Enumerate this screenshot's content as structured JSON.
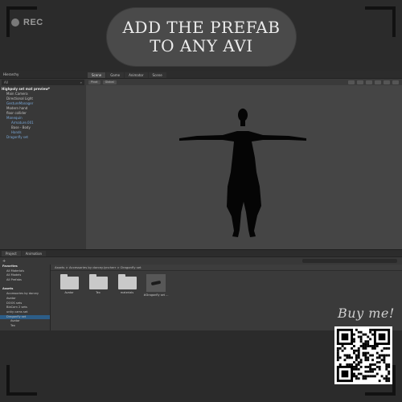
{
  "overlay": {
    "rec_label": "REC",
    "banner_line1": "ADD THE PREFAB",
    "banner_line2": "TO ANY AVI",
    "buy_label": "Buy me!"
  },
  "hierarchy": {
    "tab_label": "Hierarchy",
    "search_placeholder": "All",
    "items": [
      {
        "label": "Highpoly set mat preview*",
        "style": "root"
      },
      {
        "label": "Main Camera",
        "style": ""
      },
      {
        "label": "Directional Light",
        "style": ""
      },
      {
        "label": "GestureManager",
        "style": "blue"
      },
      {
        "label": "Modern hand",
        "style": ""
      },
      {
        "label": "floor collider",
        "style": ""
      },
      {
        "label": "Manequin",
        "style": "blue"
      },
      {
        "label": "Armature.001",
        "style": "blue"
      },
      {
        "label": "Base - Body",
        "style": ""
      },
      {
        "label": "Hands",
        "style": "blue"
      },
      {
        "label": "Dragonfly set",
        "style": "blue"
      }
    ]
  },
  "scene": {
    "tabs": [
      "Scene",
      "Game",
      "Animator",
      "Scene"
    ],
    "active_tab": 0,
    "toolbar": [
      "Pivot",
      "Global"
    ]
  },
  "bottom": {
    "tabs": [
      "Project",
      "Animation"
    ],
    "active_tab": 0,
    "add_label": "+",
    "tree": [
      {
        "label": "Favorites",
        "style": "head"
      },
      {
        "label": "All Materials",
        "style": ""
      },
      {
        "label": "All Models",
        "style": ""
      },
      {
        "label": "All Prefabs",
        "style": ""
      },
      {
        "label": "",
        "style": ""
      },
      {
        "label": "Assets",
        "style": "head"
      },
      {
        "label": "Accessories by dorcey",
        "style": ""
      },
      {
        "label": "Avatar",
        "style": ""
      },
      {
        "label": "DOOS sets",
        "style": ""
      },
      {
        "label": "BlaCam 2 sets",
        "style": ""
      },
      {
        "label": "unity cams set",
        "style": ""
      },
      {
        "label": "Dragonfly set",
        "style": "sel"
      },
      {
        "label": "Avatar",
        "style": ""
      },
      {
        "label": "Tex",
        "style": ""
      }
    ],
    "breadcrumb": "Assets > Accessories by dorcey.lyncherr > Dragonfly set",
    "assets": [
      {
        "label": "Avatar",
        "kind": "folder"
      },
      {
        "label": "Tex",
        "kind": "folder"
      },
      {
        "label": "materials",
        "kind": "folder"
      },
      {
        "label": "#Dragonfly set ...",
        "kind": "prefab"
      }
    ]
  }
}
